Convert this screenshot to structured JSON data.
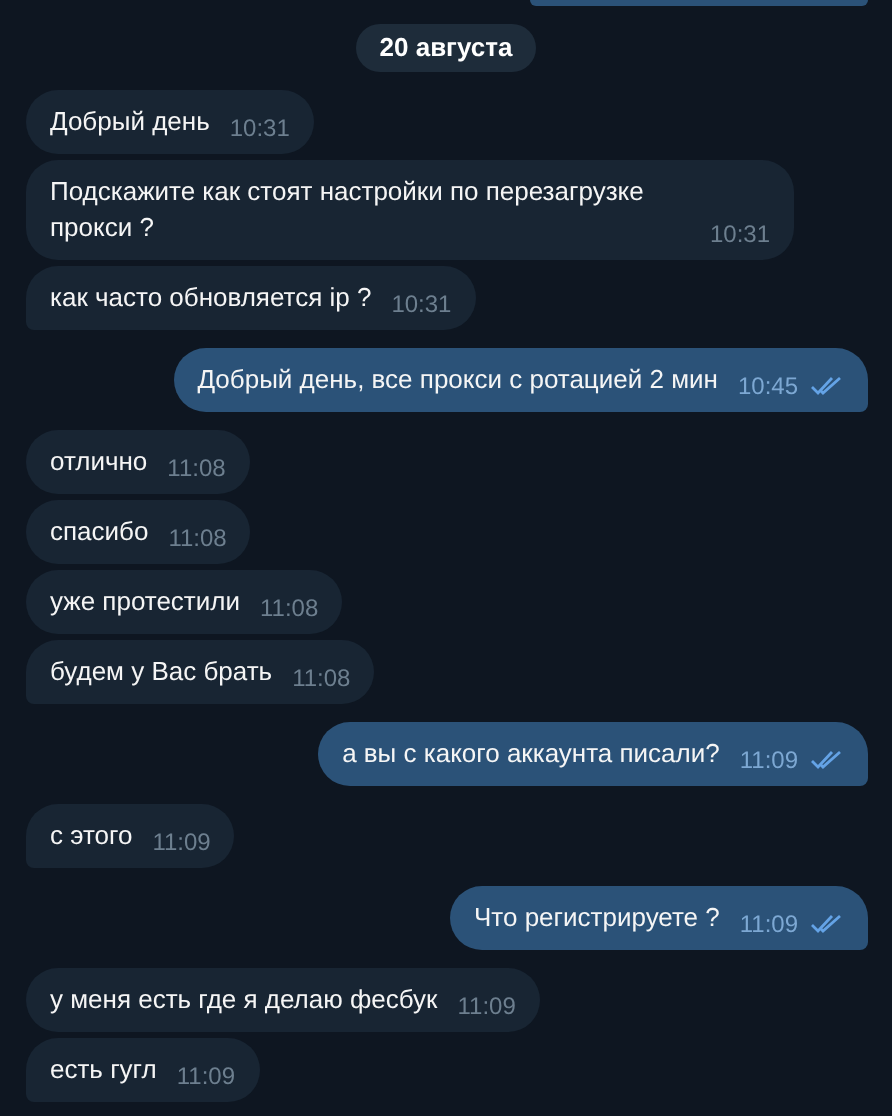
{
  "partial_bubble_above": true,
  "date": "20 августа",
  "groups": [
    {
      "kind": "incoming",
      "messages": [
        {
          "text": "Добрый день",
          "time": "10:31"
        },
        {
          "text": "Подскажите как стоят настройки по перезагрузке прокси ?",
          "time": "10:31"
        },
        {
          "text": "как часто обновляется ip ?",
          "time": "10:31"
        }
      ]
    },
    {
      "kind": "outgoing",
      "messages": [
        {
          "text": "Добрый день, все прокси с ротацией 2 мин",
          "time": "10:45",
          "read": true
        }
      ]
    },
    {
      "kind": "incoming",
      "messages": [
        {
          "text": "отлично",
          "time": "11:08"
        },
        {
          "text": "спасибо",
          "time": "11:08"
        },
        {
          "text": "уже протестили",
          "time": "11:08"
        },
        {
          "text": "будем у Вас брать",
          "time": "11:08"
        }
      ]
    },
    {
      "kind": "outgoing",
      "messages": [
        {
          "text": "а вы с какого аккаунта писали?",
          "time": "11:09",
          "read": true
        }
      ]
    },
    {
      "kind": "incoming",
      "messages": [
        {
          "text": "с этого",
          "time": "11:09"
        }
      ]
    },
    {
      "kind": "outgoing",
      "messages": [
        {
          "text": "Что регистрируете ?",
          "time": "11:09",
          "read": true
        }
      ]
    },
    {
      "kind": "incoming",
      "messages": [
        {
          "text": "у меня есть где я делаю фесбук",
          "time": "11:09"
        },
        {
          "text": "есть гугл",
          "time": "11:09"
        }
      ]
    }
  ]
}
